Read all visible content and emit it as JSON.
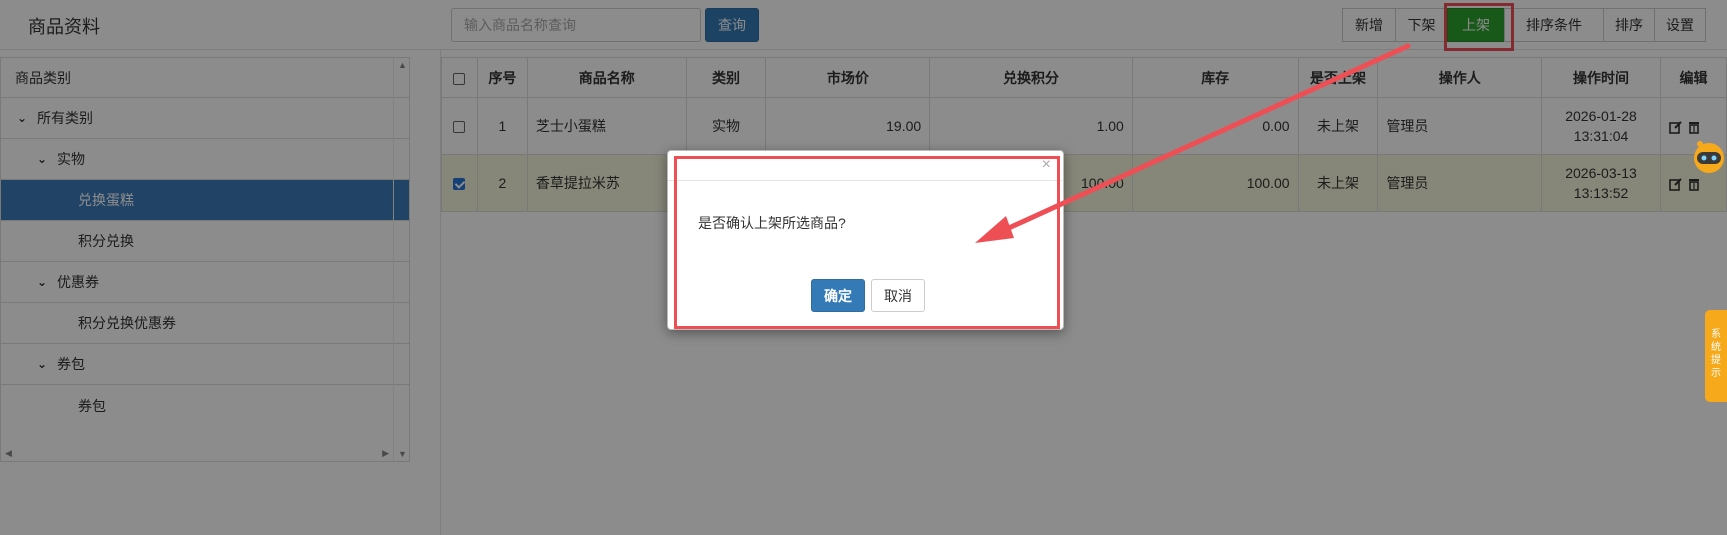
{
  "header": {
    "title": "商品资料",
    "search_placeholder": "输入商品名称查询",
    "query_label": "查询",
    "toolbar": [
      "新增",
      "下架",
      "上架",
      "排序条件",
      "排序",
      "设置"
    ]
  },
  "tree": {
    "title": "商品类别",
    "items": [
      {
        "label": "所有类别",
        "level": 0,
        "expanded": true
      },
      {
        "label": "实物",
        "level": 1,
        "expanded": true
      },
      {
        "label": "兑换蛋糕",
        "level": 2,
        "selected": true
      },
      {
        "label": "积分兑换",
        "level": 2
      },
      {
        "label": "优惠券",
        "level": 1,
        "expanded": true
      },
      {
        "label": "积分兑换优惠券",
        "level": 2
      },
      {
        "label": "券包",
        "level": 1,
        "expanded": true
      },
      {
        "label": "券包",
        "level": 2
      }
    ]
  },
  "table": {
    "columns": [
      "序号",
      "商品名称",
      "类别",
      "市场价",
      "兑换积分",
      "库存",
      "是否上架",
      "操作人",
      "操作时间",
      "编辑"
    ],
    "rows": [
      {
        "no": "1",
        "name": "芝士小蛋糕",
        "type": "实物",
        "price": "19.00",
        "points": "1.00",
        "stock": "0.00",
        "status": "未上架",
        "operator": "管理员",
        "time1": "2026-01-28",
        "time2": "13:31:04",
        "checked": false
      },
      {
        "no": "2",
        "name": "香草提拉米苏",
        "type": "",
        "price": "",
        "points": "100.00",
        "stock": "100.00",
        "status": "未上架",
        "operator": "管理员",
        "time1": "2026-03-13",
        "time2": "13:13:52",
        "checked": true
      }
    ]
  },
  "dialog": {
    "message": "是否确认上架所选商品?",
    "ok_label": "确定",
    "cancel_label": "取消",
    "close_glyph": "×"
  },
  "side_tab": {
    "label": "系统提示"
  },
  "colors": {
    "primary": "#337ab7",
    "green": "#2ca02c",
    "highlight": "#ee4f55",
    "selected_row": "#f5f5dc",
    "tree_selected": "#3c7abb",
    "side_tab": "#f7a91c"
  }
}
